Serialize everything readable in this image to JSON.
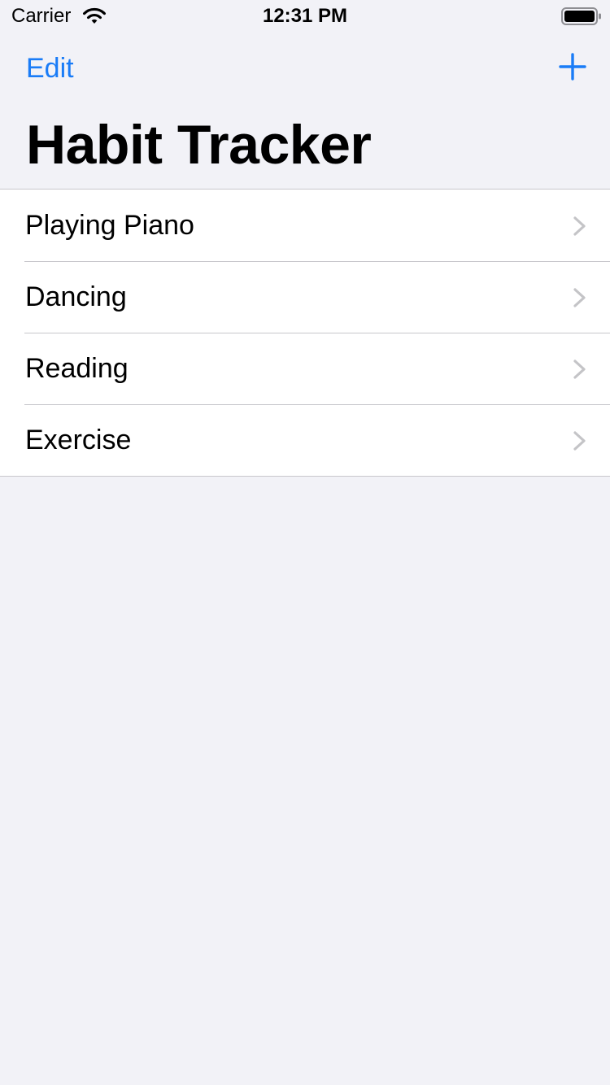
{
  "status_bar": {
    "carrier": "Carrier",
    "time": "12:31 PM",
    "wifi_icon": "wifi-icon",
    "battery_icon": "battery-icon"
  },
  "nav": {
    "edit_label": "Edit",
    "add_icon": "plus-icon",
    "title": "Habit Tracker"
  },
  "habits": [
    {
      "label": "Playing Piano"
    },
    {
      "label": "Dancing"
    },
    {
      "label": "Reading"
    },
    {
      "label": "Exercise"
    }
  ],
  "colors": {
    "accent": "#1a7cf7",
    "background": "#f2f2f7",
    "separator": "#c8c7cc",
    "chevron": "#c4c4c7"
  }
}
